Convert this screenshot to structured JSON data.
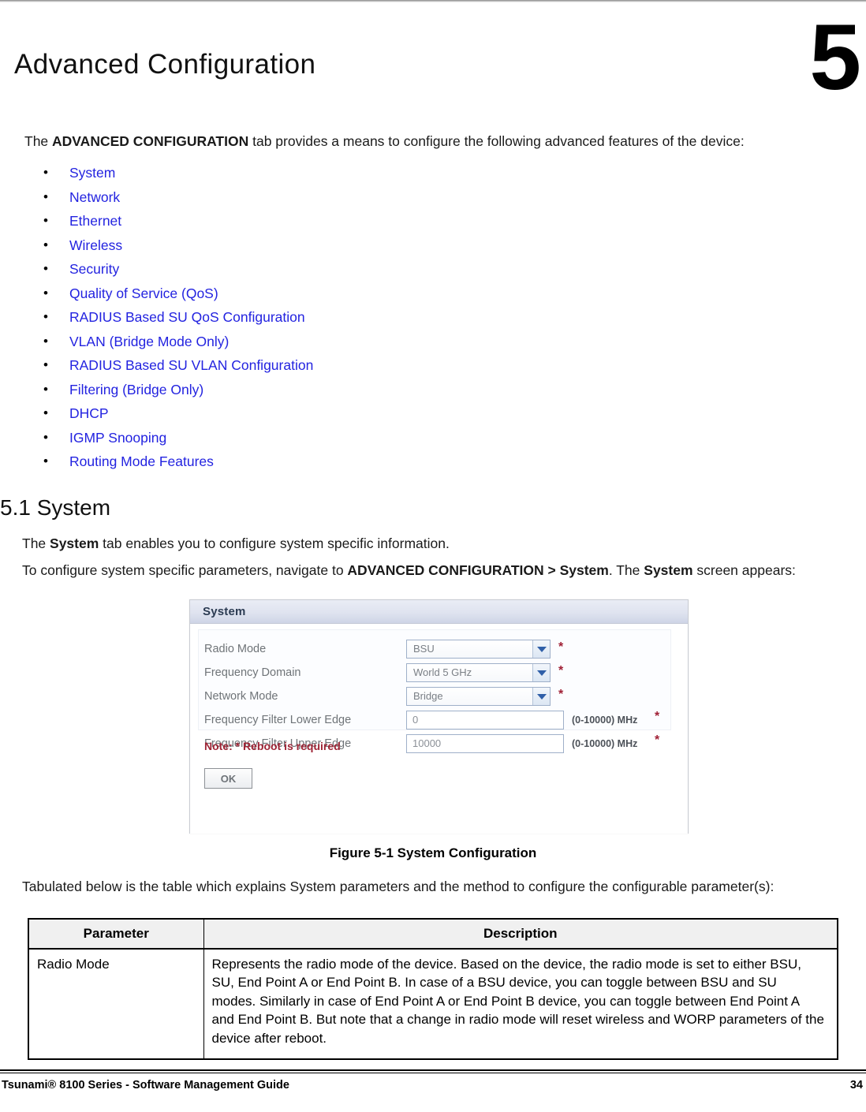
{
  "page": {
    "chapter_number": "5",
    "chapter_title": "Advanced Configuration"
  },
  "intro": {
    "prefix": "The ",
    "bold_term": "ADVANCED CONFIGURATION",
    "suffix": " tab provides a means to configure the following advanced features of the device:"
  },
  "feature_list": [
    {
      "bullet": "•",
      "label": "System"
    },
    {
      "bullet": "•",
      "label": "Network"
    },
    {
      "bullet": "•",
      "label": "Ethernet"
    },
    {
      "bullet": "•",
      "label": "Wireless"
    },
    {
      "bullet": "•",
      "label": "Security"
    },
    {
      "bullet": "•",
      "label": "Quality of Service (QoS)"
    },
    {
      "bullet": "•",
      "label": "RADIUS Based SU QoS Configuration"
    },
    {
      "bullet": "•",
      "label": "VLAN (Bridge Mode Only)"
    },
    {
      "bullet": "•",
      "label": "RADIUS Based SU VLAN Configuration"
    },
    {
      "bullet": "•",
      "label": "Filtering (Bridge Only)"
    },
    {
      "bullet": "•",
      "label": "DHCP"
    },
    {
      "bullet": "•",
      "label": "IGMP Snooping"
    },
    {
      "bullet": "•",
      "label": "Routing Mode Features"
    }
  ],
  "section": {
    "heading": "5.1 System",
    "para1_prefix": "The ",
    "para1_bold": "System",
    "para1_suffix": " tab enables you to configure system specific information.",
    "para2_prefix": "To configure system specific parameters, navigate to ",
    "para2_bold1": "ADVANCED CONFIGURATION > System",
    "para2_mid": ". The ",
    "para2_bold2": "System",
    "para2_suffix": " screen appears:"
  },
  "screenshot": {
    "title": "System",
    "rows": [
      {
        "label": "Radio Mode",
        "type": "select",
        "value": "BSU",
        "required": "*"
      },
      {
        "label": "Frequency Domain",
        "type": "select",
        "value": "World 5 GHz",
        "required": "*"
      },
      {
        "label": "Network Mode",
        "type": "select",
        "value": "Bridge",
        "required": "*"
      },
      {
        "label": "Frequency Filter Lower Edge",
        "type": "text",
        "value": "0",
        "unit": "(0-10000) MHz",
        "required": "*"
      },
      {
        "label": "Frequency Filter Upper Edge",
        "type": "text",
        "value": "10000",
        "unit": "(0-10000) MHz",
        "required": "*"
      }
    ],
    "note": "Note: * Reboot is required",
    "ok_label": "OK"
  },
  "figure": {
    "caption": "Figure 5-1 System Configuration"
  },
  "tabulated_para": "Tabulated below is the table which explains System parameters and the method to configure the configurable parameter(s):",
  "table": {
    "headers": [
      "Parameter",
      "Description"
    ],
    "rows": [
      {
        "parameter": "Radio Mode",
        "description": "Represents the radio mode of the device. Based on the device, the radio mode is set to either BSU, SU, End Point A or End Point B. In case of a BSU device, you can toggle between BSU and SU modes. Similarly in case of End Point A or End Point B device, you can toggle between End Point A and End Point B. But note that a change in radio mode will reset wireless and WORP parameters of the device after reboot."
      }
    ]
  },
  "footer": {
    "text": "Tsunami® 8100 Series - Software Management Guide",
    "page_number": "34"
  },
  "colors": {
    "link": "#2323e0",
    "note_red": "#9e2334",
    "panel_header": "#dfe3ef"
  }
}
